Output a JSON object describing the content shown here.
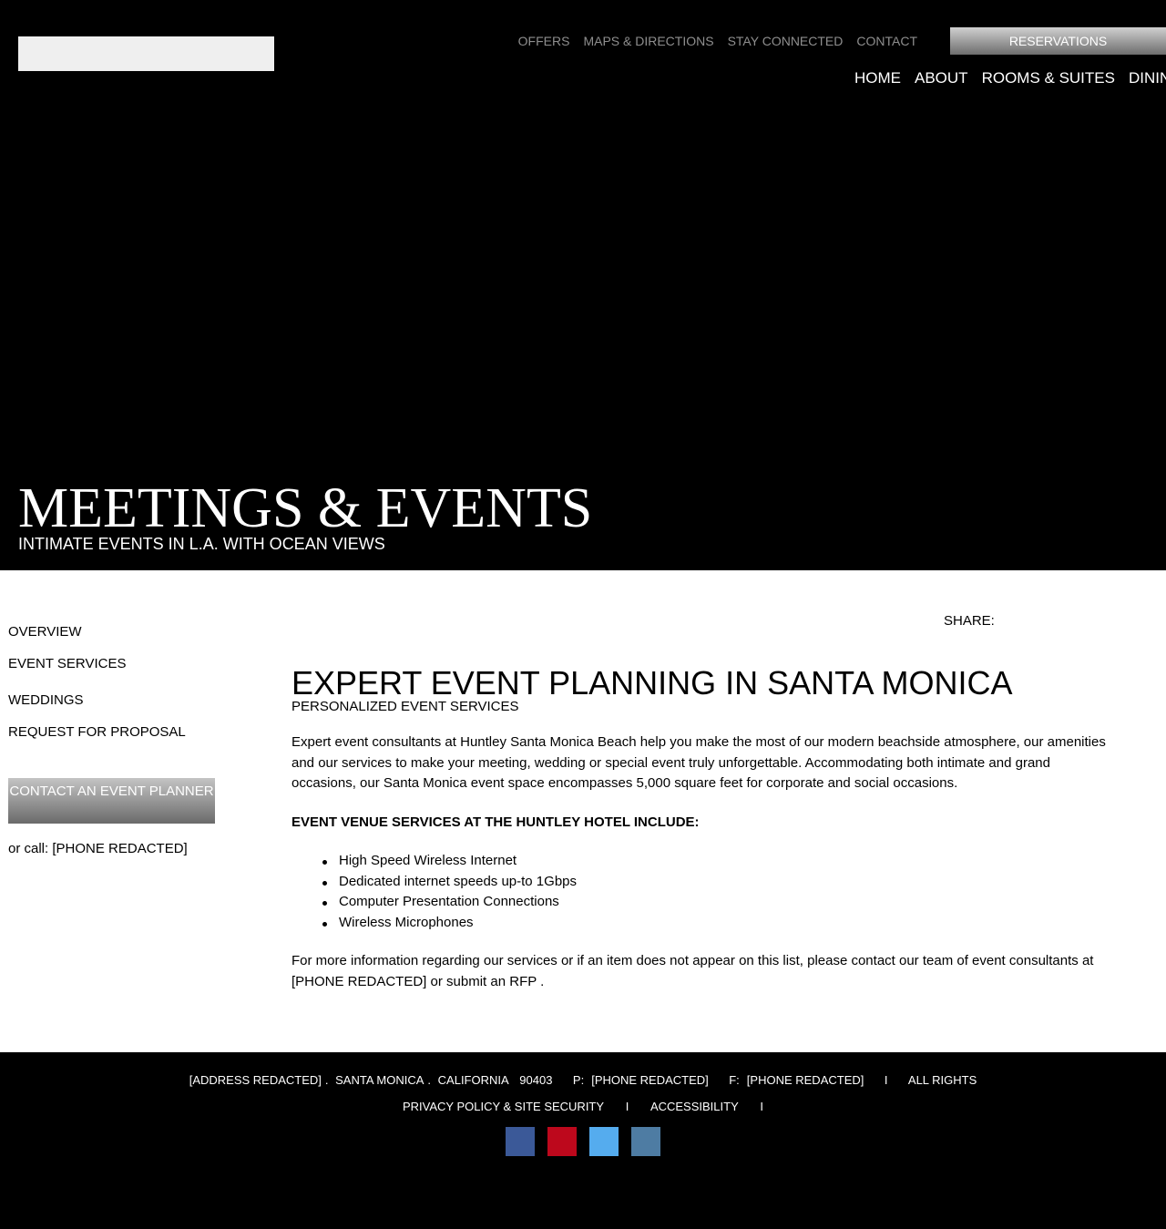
{
  "header": {
    "utility_nav": [
      "OFFERS",
      "MAPS & DIRECTIONS",
      "STAY CONNECTED",
      "CONTACT"
    ],
    "reservations_label": "RESERVATIONS",
    "main_nav": [
      "HOME",
      "ABOUT",
      "ROOMS & SUITES",
      "DINING"
    ]
  },
  "hero": {
    "title": "MEETINGS & EVENTS",
    "subtitle": "INTIMATE EVENTS IN L.A. WITH OCEAN VIEWS"
  },
  "sidebar": {
    "items": [
      "OVERVIEW",
      "EVENT SERVICES",
      "WEDDINGS",
      "REQUEST FOR PROPOSAL"
    ],
    "contact_button": "CONTACT AN EVENT PLANNER",
    "call_text": "or call: [PHONE REDACTED]"
  },
  "share_label": "SHARE:",
  "main": {
    "heading": "EXPERT EVENT PLANNING IN SANTA MONICA",
    "subheading": "PERSONALIZED EVENT SERVICES",
    "intro": "Expert event consultants at Huntley Santa Monica Beach help you make the most of our modern beachside atmosphere, our amenities and our services to make your meeting, wedding or special event truly unforgettable. Accommodating both intimate and grand occasions, our Santa Monica event space encompasses 5,000 square feet for corporate and social occasions.",
    "services_heading": "EVENT VENUE SERVICES AT THE HUNTLEY HOTEL INCLUDE:",
    "services": [
      "High Speed Wireless Internet",
      "Dedicated internet speeds up-to 1Gbps",
      "Computer Presentation Connections",
      "Wireless Microphones"
    ],
    "more_info_text": "For more information regarding our services or if an item does not appear on this list, please contact our team of event consultants at [PHONE REDACTED] or",
    "rfp_link": "submit an RFP",
    "more_info_end": "."
  },
  "footer": {
    "address": "[ADDRESS REDACTED]",
    "city": "SANTA MONICA",
    "state": "CALIFORNIA",
    "zip": "90403",
    "phone_label": "P:",
    "phone": "[PHONE REDACTED]",
    "fax_label": "F:",
    "fax": "[PHONE REDACTED]",
    "separator": "I",
    "rights": "ALL RIGHTS",
    "privacy": "PRIVACY POLICY & SITE SECURITY",
    "accessibility": "ACCESSIBILITY",
    "social": [
      {
        "name": "facebook-icon",
        "color": "#3b5998"
      },
      {
        "name": "pinterest-icon",
        "color": "#bd081c"
      },
      {
        "name": "twitter-icon",
        "color": "#55acee"
      },
      {
        "name": "linkedin-icon",
        "color": "#4e7ca3"
      }
    ]
  }
}
